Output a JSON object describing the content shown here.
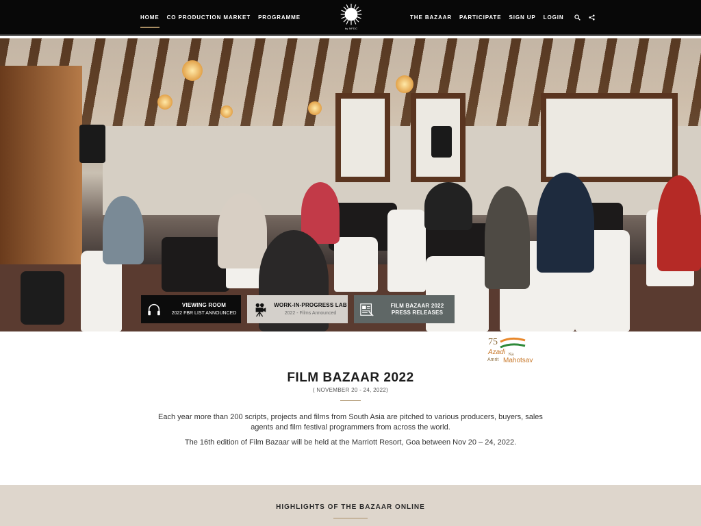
{
  "nav": {
    "left": [
      "HOME",
      "CO PRODUCTION MARKET",
      "PROGRAMME"
    ],
    "right": [
      "THE BAZAAR",
      "PARTICIPATE",
      "SIGN UP",
      "LOGIN"
    ],
    "logo_text": "Film Bazaar",
    "logo_sub": "by NFDC",
    "icons": [
      "search-icon",
      "share-icon"
    ]
  },
  "hero": {
    "buttons": [
      {
        "title": "VIEWING ROOM",
        "subtitle": "2022 FBR LIST ANNOUNCED",
        "icon": "headphones-icon"
      },
      {
        "title": "WORK-IN-PROGRESS LAB",
        "subtitle": "2022 - Films Announced",
        "icon": "film-camera-icon"
      },
      {
        "title": "FILM BAZAAR 2022",
        "subtitle": "PRESS RELEASES",
        "icon": "press-release-icon"
      }
    ]
  },
  "azadi": {
    "number": "75",
    "line1": "Azadi",
    "line2": "Ka",
    "line3": "Amrit",
    "line4": "Mahotsav"
  },
  "intro": {
    "title": "FILM BAZAAR 2022",
    "dates": "( NOVEMBER 20 - 24, 2022)",
    "para1": "Each year more than 200 scripts, projects and films from South Asia are pitched to various producers, buyers, sales agents and film festival programmers from across the world.",
    "para2": "The 16th edition of Film Bazaar will be held at the Marriott Resort, Goa between Nov 20 – 24, 2022."
  },
  "highlights": {
    "heading": "HIGHLIGHTS OF THE BAZAAR ONLINE"
  },
  "colors": {
    "accent": "#a88d63",
    "nav_bg": "#080808",
    "band_bg": "#ded6cc"
  }
}
